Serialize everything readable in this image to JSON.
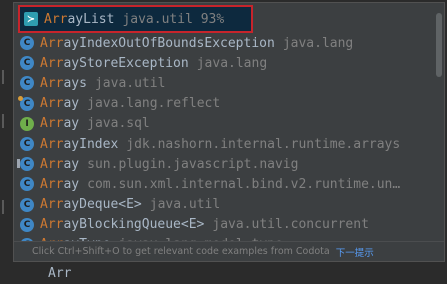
{
  "completion": {
    "items": [
      {
        "icon": "class-icon",
        "match": "Arr",
        "rest": "ayList",
        "suffix": "",
        "pkg": "java.util 93%",
        "selected": true
      },
      {
        "icon": "class-icon",
        "match": "Arr",
        "rest": "ayIndexOutOfBoundsException",
        "suffix": "",
        "pkg": "java.lang"
      },
      {
        "icon": "class-icon",
        "match": "Arr",
        "rest": "ayStoreException",
        "suffix": "",
        "pkg": "java.lang"
      },
      {
        "icon": "class-icon",
        "match": "Arr",
        "rest": "ays",
        "suffix": "",
        "pkg": "java.util"
      },
      {
        "icon": "class-icon",
        "match": "Arr",
        "rest": "ay",
        "suffix": "",
        "pkg": "java.lang.reflect"
      },
      {
        "icon": "interface-icon",
        "match": "Arr",
        "rest": "ay",
        "suffix": "",
        "pkg": "java.sql"
      },
      {
        "icon": "class-icon",
        "match": "Arr",
        "rest": "ayIndex",
        "suffix": "",
        "pkg": "jdk.nashorn.internal.runtime.arrays"
      },
      {
        "icon": "class-icon",
        "match": "Arr",
        "rest": "ay",
        "suffix": "",
        "pkg": "sun.plugin.javascript.navig"
      },
      {
        "icon": "class-icon",
        "match": "Arr",
        "rest": "ay",
        "suffix": "",
        "pkg": "com.sun.xml.internal.bind.v2.runtime.un…"
      },
      {
        "icon": "class-icon",
        "match": "Arr",
        "rest": "ayDeque<E>",
        "suffix": "",
        "pkg": "java.util"
      },
      {
        "icon": "class-icon",
        "match": "Arr",
        "rest": "ayBlockingQueue<E>",
        "suffix": "",
        "pkg": "java.util.concurrent"
      },
      {
        "icon": "class-icon",
        "match": "Arr",
        "rest": "ayType",
        "suffix": "",
        "pkg": "javax.lang.model.type"
      }
    ],
    "footer_hint": "Click Ctrl+Shift+O to get relevant code examples from Codota",
    "footer_next": "下一提示"
  },
  "editor": {
    "typed_text": "Arr"
  },
  "colors": {
    "popup_bg": "#3c3f41",
    "selection_bg": "#0d293e",
    "highlight_border": "#c7242b",
    "match_color": "#cc7832",
    "link_color": "#589df6"
  }
}
